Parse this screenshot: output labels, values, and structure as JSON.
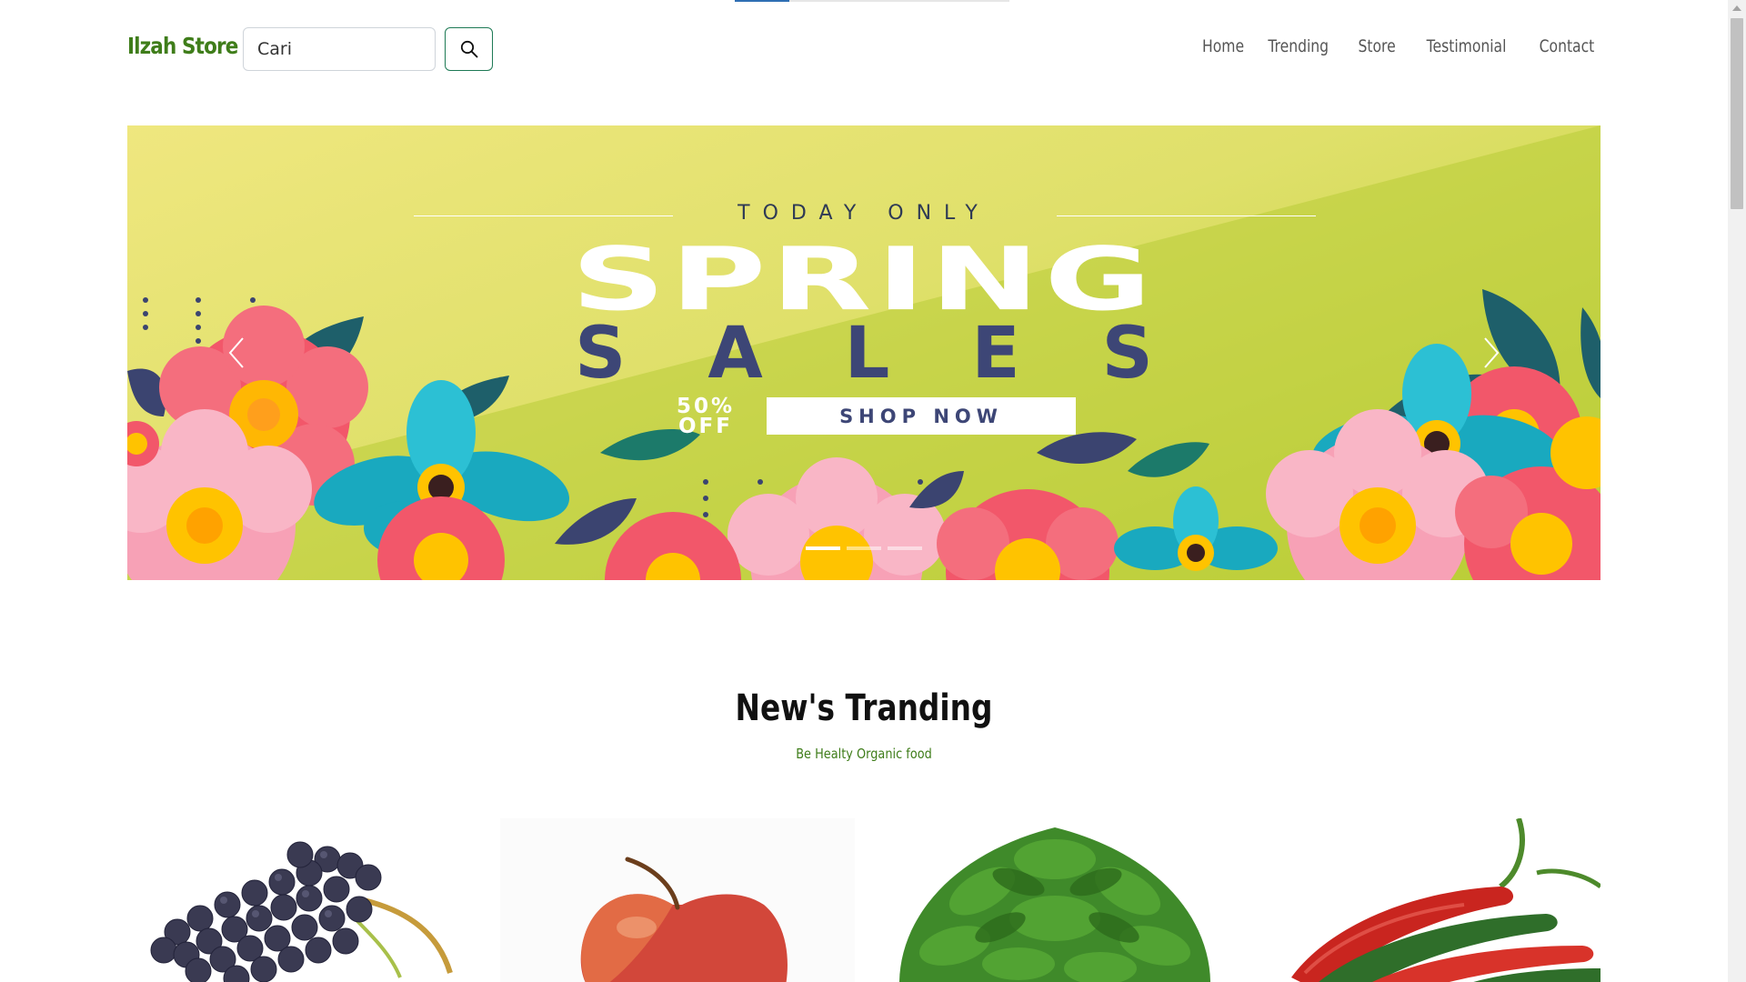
{
  "navbar": {
    "brand": "Ilzah Store",
    "search_placeholder": "Cari",
    "links": [
      "Home",
      "Trending",
      "Store",
      "Testimonial",
      "Contact"
    ]
  },
  "hero": {
    "kicker": "TODAY ONLY",
    "headline": "SPRING",
    "subheadline": "SALES",
    "discount": "50%",
    "discount_suffix": "OFF",
    "cta": "SHOP NOW",
    "slides_count": 3,
    "active_slide": 1
  },
  "trending": {
    "title": "New's Tranding",
    "subtitle": "Be Healty Organic food"
  },
  "products": [
    {
      "image": "grapes"
    },
    {
      "image": "apple"
    },
    {
      "image": "spinach"
    },
    {
      "image": "chili-peppers"
    }
  ],
  "colors": {
    "brand": "#3f7d1a",
    "accent_button": "#1e7a55",
    "hero_text": "#3d4676"
  },
  "icons": {
    "search": "search-icon",
    "prev": "chevron-left-icon",
    "next": "chevron-right-icon"
  }
}
